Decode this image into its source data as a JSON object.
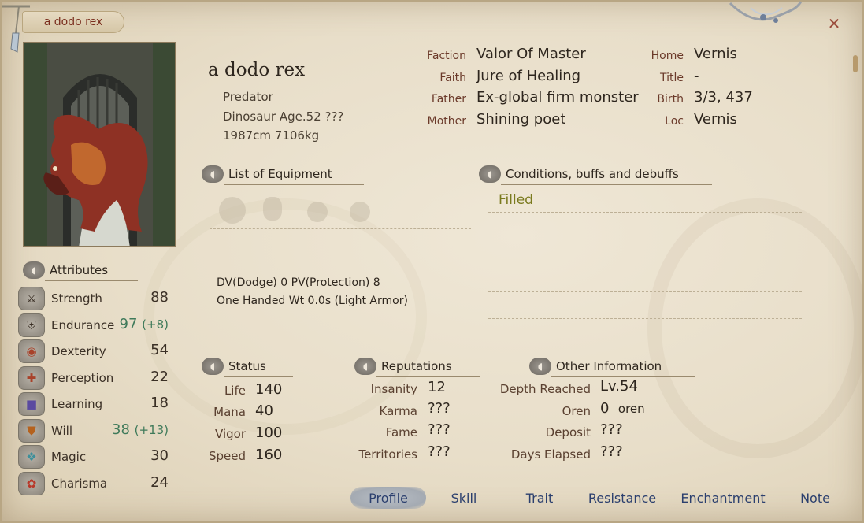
{
  "window": {
    "title": "a dodo rex",
    "accent": "#7a2e1e"
  },
  "character": {
    "name": "a dodo rex",
    "class": "Predator",
    "race_age": "Dinosaur Age.52 ???",
    "size": "1987cm 7106kg"
  },
  "info": {
    "faction_label": "Faction",
    "faction": "Valor Of Master",
    "faith_label": "Faith",
    "faith": "Jure of Healing",
    "father_label": "Father",
    "father": "Ex-global firm monster",
    "mother_label": "Mother",
    "mother": "Shining poet",
    "home_label": "Home",
    "home": "Vernis",
    "title_label": "Title",
    "title": "-",
    "birth_label": "Birth",
    "birth": "3/3, 437",
    "loc_label": "Loc",
    "loc": "Vernis"
  },
  "equipment": {
    "heading": "List of Equipment",
    "armor_line1": "DV(Dodge) 0   PV(Protection) 8",
    "armor_line2": "One Handed Wt 0.0s (Light Armor)"
  },
  "conditions": {
    "heading": "Conditions, buffs and debuffs",
    "items": [
      "Filled"
    ],
    "color": "#7a7a1e"
  },
  "attributes": {
    "heading": "Attributes",
    "items": [
      {
        "label": "Strength",
        "value": "88",
        "bonus": "",
        "icon": "crossed-swords-icon"
      },
      {
        "label": "Endurance",
        "value": "97",
        "bonus": "(+8)",
        "icon": "armor-icon"
      },
      {
        "label": "Dexterity",
        "value": "54",
        "bonus": "",
        "icon": "glove-icon"
      },
      {
        "label": "Perception",
        "value": "22",
        "bonus": "",
        "icon": "target-icon"
      },
      {
        "label": "Learning",
        "value": "18",
        "bonus": "",
        "icon": "book-icon"
      },
      {
        "label": "Will",
        "value": "38",
        "bonus": "(+13)",
        "icon": "shield-icon"
      },
      {
        "label": "Magic",
        "value": "30",
        "bonus": "",
        "icon": "magic-circle-icon"
      },
      {
        "label": "Charisma",
        "value": "24",
        "bonus": "",
        "icon": "ribbon-icon"
      }
    ],
    "bonus_color": "#3f7a5a"
  },
  "status": {
    "heading": "Status",
    "items": [
      {
        "label": "Life",
        "value": "140"
      },
      {
        "label": "Mana",
        "value": "40"
      },
      {
        "label": "Vigor",
        "value": "100"
      },
      {
        "label": "Speed",
        "value": "160"
      }
    ]
  },
  "reputations": {
    "heading": "Reputations",
    "items": [
      {
        "label": "Insanity",
        "value": "12"
      },
      {
        "label": "Karma",
        "value": "???"
      },
      {
        "label": "Fame",
        "value": "???"
      },
      {
        "label": "Territories",
        "value": "???"
      }
    ]
  },
  "other": {
    "heading": "Other Information",
    "depth_label": "Depth Reached",
    "depth": "Lv.54",
    "oren_label": "Oren",
    "oren_value": "0",
    "oren_unit": "oren",
    "deposit_label": "Deposit",
    "deposit": "???",
    "days_label": "Days Elapsed",
    "days": "???"
  },
  "tabs": {
    "items": [
      "Profile",
      "Skill",
      "Trait",
      "Resistance",
      "Enchantment",
      "Note"
    ],
    "active": "Profile",
    "color": "#2b3f6e"
  },
  "close_icon": "close-icon"
}
